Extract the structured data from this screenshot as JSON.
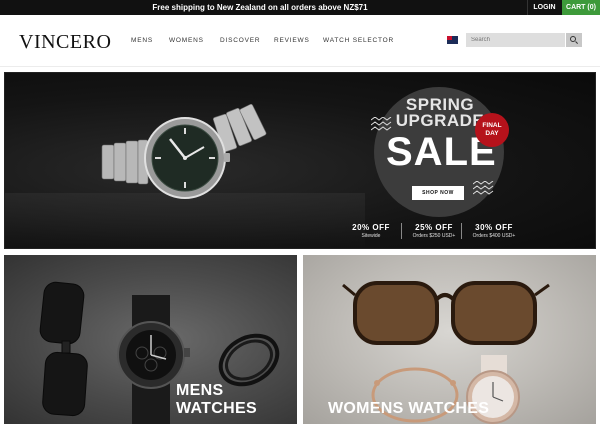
{
  "topbar": {
    "promo": "Free shipping to New Zealand on all orders above NZ$71",
    "login": "LOGIN",
    "cart": "CART (0)"
  },
  "header": {
    "logo": "VINCERO",
    "nav": [
      "MENS",
      "WOMENS",
      "DISCOVER",
      "REVIEWS",
      "WATCH SELECTOR"
    ],
    "search_placeholder": "Search"
  },
  "hero": {
    "headline_1": "SPRING",
    "headline_2": "UPGRADE",
    "sale": "SALE",
    "badge_1": "FINAL",
    "badge_2": "DAY",
    "button": "SHOP NOW",
    "offers": [
      {
        "pct": "20% OFF",
        "cond": "Sitewide"
      },
      {
        "pct": "25% OFF",
        "cond": "Orders $250 USD+"
      },
      {
        "pct": "30% OFF",
        "cond": "Orders $400 USD+"
      }
    ]
  },
  "categories": [
    {
      "label": "MENS WATCHES"
    },
    {
      "label": "WOMENS WATCHES"
    }
  ],
  "colors": {
    "topbar": "#111111",
    "cart": "#3d9a3a",
    "badge": "#b5121b"
  }
}
